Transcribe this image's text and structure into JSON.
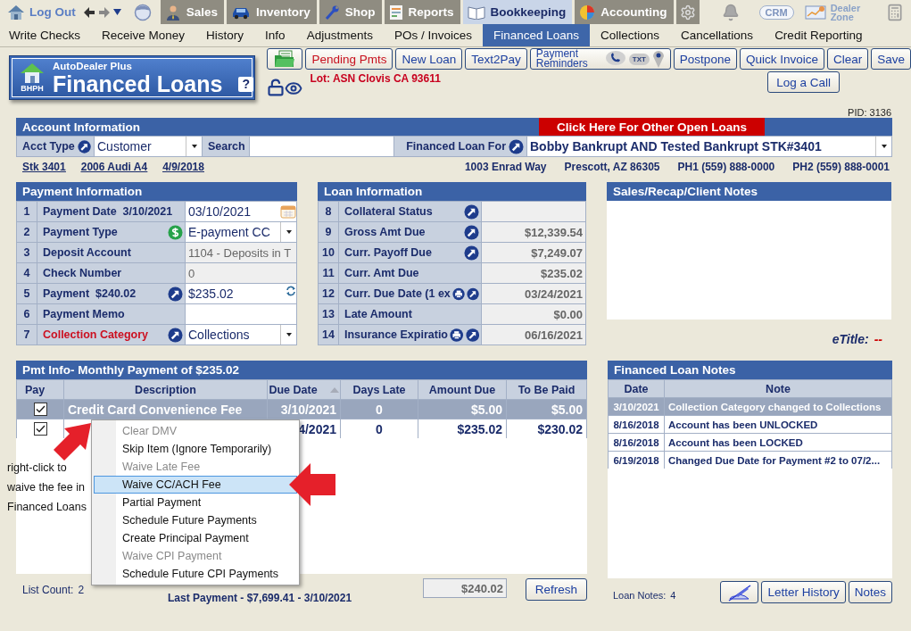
{
  "top_nav": {
    "logout": "Log Out",
    "tabs": [
      {
        "label": "Sales",
        "kind": "sales",
        "selected": false
      },
      {
        "label": "Inventory",
        "kind": "inventory",
        "selected": false
      },
      {
        "label": "Shop",
        "kind": "shop",
        "selected": false
      },
      {
        "label": "Reports",
        "kind": "reports",
        "selected": false
      },
      {
        "label": "Bookkeeping",
        "kind": "bookkeeping",
        "selected": true
      },
      {
        "label": "Accounting",
        "kind": "accounting",
        "selected": false
      }
    ],
    "crm": "CRM",
    "dealer_zone": "Dealer Zone"
  },
  "sub_nav": [
    {
      "label": "Write Checks",
      "selected": false
    },
    {
      "label": "Receive Money",
      "selected": false
    },
    {
      "label": "History",
      "selected": false
    },
    {
      "label": "Info",
      "selected": false
    },
    {
      "label": "Adjustments",
      "selected": false
    },
    {
      "label": "POs / Invoices",
      "selected": false
    },
    {
      "label": "Financed Loans",
      "selected": true
    },
    {
      "label": "Collections",
      "selected": false
    },
    {
      "label": "Cancellations",
      "selected": false
    },
    {
      "label": "Credit Reporting",
      "selected": false
    }
  ],
  "header": {
    "brand": "AutoDealer Plus",
    "badge": "BHPH",
    "title": "Financed Loans",
    "help": "?",
    "buttons": [
      {
        "kind": "folder"
      },
      {
        "kind": "alert",
        "label": "Pending Pmts"
      },
      {
        "kind": "plain",
        "label": "New Loan"
      },
      {
        "kind": "plain",
        "label": "Text2Pay"
      },
      {
        "kind": "reminders",
        "label": "Payment Reminders",
        "badge": "TXT"
      },
      {
        "kind": "plain",
        "label": "Postpone"
      },
      {
        "kind": "plain",
        "label": "Quick Invoice"
      },
      {
        "kind": "plain",
        "label": "Clear"
      },
      {
        "kind": "plain",
        "label": "Save"
      }
    ],
    "lot": "Lot: ASN Clovis CA 93611",
    "log_call": "Log a Call",
    "pid": "PID: 3136"
  },
  "account": {
    "title": "Account Information",
    "other_loans": "Click Here For Other Open Loans",
    "acct_type_label": "Acct Type",
    "acct_type": "Customer",
    "search_label": "Search",
    "loan_for_label": "Financed Loan For",
    "loan_for": "Bobby Bankrupt AND Tested Bankrupt STK#3401",
    "vehicle": [
      "Stk 3401",
      "2006 Audi A4",
      "4/9/2018"
    ],
    "contact": [
      "1003 Enrad Way",
      "Prescott, AZ 86305",
      "PH1 (559) 888-0000",
      "PH2 (559) 888-0001"
    ]
  },
  "payment_info": {
    "title": "Payment Information",
    "rows": [
      {
        "num": "1",
        "label": "Payment Date  3/10/2021",
        "alert": false,
        "kind": "date",
        "value": "03/10/2021"
      },
      {
        "num": "2",
        "label": "Payment Type",
        "alert": false,
        "kind": "pay-select",
        "value": "E-payment CC"
      },
      {
        "num": "3",
        "label": "Deposit Account",
        "alert": false,
        "kind": "readonly",
        "value": "1104 - Deposits in T"
      },
      {
        "num": "4",
        "label": "Check Number",
        "alert": false,
        "kind": "readonly",
        "value": "0"
      },
      {
        "num": "5",
        "label": "Payment  $240.02",
        "alert": false,
        "kind": "amount",
        "value": "$235.02"
      },
      {
        "num": "6",
        "label": "Payment Memo",
        "alert": false,
        "kind": "input"
      },
      {
        "num": "7",
        "label": "Collection Category",
        "alert": true,
        "kind": "jump-select",
        "value": "Collections"
      }
    ]
  },
  "loan_info": {
    "title": "Loan Information",
    "rows": [
      {
        "num": "8",
        "label": "Collateral Status",
        "kind": "jump"
      },
      {
        "num": "9",
        "label": "Gross Amt Due",
        "kind": "jump",
        "value": "$12,339.54"
      },
      {
        "num": "10",
        "label": "Curr. Payoff Due",
        "kind": "jump",
        "value": "$7,249.07"
      },
      {
        "num": "11",
        "label": "Curr. Amt Due",
        "kind": "plain",
        "value": "$235.02"
      },
      {
        "num": "12",
        "label": "Curr. Due Date (1 ex",
        "kind": "print-jump",
        "value": "03/24/2021"
      },
      {
        "num": "13",
        "label": "Late Amount",
        "kind": "plain",
        "value": "$0.00"
      },
      {
        "num": "14",
        "label": "Insurance Expiratio",
        "kind": "print-jump",
        "value": "06/16/2021"
      }
    ]
  },
  "sales_notes": {
    "title": "Sales/Recap/Client Notes"
  },
  "etitle": {
    "label": "eTitle:",
    "value": "--"
  },
  "payments": {
    "title": "Pmt Info- Monthly Payment of $235.02",
    "columns": [
      {
        "label": "Pay",
        "sorted": false
      },
      {
        "label": "Description",
        "sorted": false
      },
      {
        "label": "Due Date",
        "sorted": true
      },
      {
        "label": "Days Late",
        "sorted": false
      },
      {
        "label": "Amount Due",
        "sorted": false
      },
      {
        "label": "To Be Paid",
        "sorted": false
      }
    ],
    "rows": [
      {
        "checked": true,
        "selected": true,
        "description": "Credit Card Convenience Fee",
        "due_date": "3/10/2021",
        "days_late": "0",
        "amount_due": "$5.00",
        "to_be_paid": "$5.00"
      },
      {
        "checked": true,
        "selected": false,
        "due_date": "4/2021",
        "days_late": "0",
        "amount_due": "$235.02",
        "to_be_paid": "$230.02"
      }
    ],
    "list_count_label": "List Count:",
    "list_count": "2",
    "last_payment": "Last Payment - $7,699.41 - 3/10/2021",
    "total": "$240.02",
    "refresh": "Refresh"
  },
  "context_menu": [
    {
      "label": "Clear DMV",
      "disabled": true,
      "selected": false
    },
    {
      "label": "Skip Item (Ignore Temporarily)",
      "disabled": false,
      "selected": false
    },
    {
      "label": "Waive Late Fee",
      "disabled": true,
      "selected": false
    },
    {
      "label": "Waive CC/ACH Fee",
      "disabled": false,
      "selected": true
    },
    {
      "label": "Partial Payment",
      "disabled": false,
      "selected": false
    },
    {
      "label": "Schedule Future Payments",
      "disabled": false,
      "selected": false
    },
    {
      "label": "Create Principal Payment",
      "disabled": false,
      "selected": false
    },
    {
      "label": "Waive CPI Payment",
      "disabled": true,
      "selected": false
    },
    {
      "label": "Schedule Future CPI Payments",
      "disabled": false,
      "selected": false
    }
  ],
  "annotation": "right-click to waive the fee in Financed Loans",
  "loan_notes": {
    "title": "Financed Loan Notes",
    "columns": [
      "Date",
      "Note"
    ],
    "rows": [
      {
        "date": "3/10/2021",
        "note": "Collection Category changed to Collections",
        "selected": true
      },
      {
        "date": "8/16/2018",
        "note": "Account has been UNLOCKED",
        "selected": false
      },
      {
        "date": "8/16/2018",
        "note": "Account has been LOCKED",
        "selected": false
      },
      {
        "date": "6/19/2018",
        "note": "Changed Due Date for Payment #2 to 07/2...",
        "selected": false
      }
    ],
    "count_label": "Loan Notes:",
    "count": "4",
    "buttons": [
      {
        "kind": "pen"
      },
      {
        "kind": "plain",
        "label": "Letter History"
      },
      {
        "kind": "plain",
        "label": "Notes"
      }
    ]
  }
}
